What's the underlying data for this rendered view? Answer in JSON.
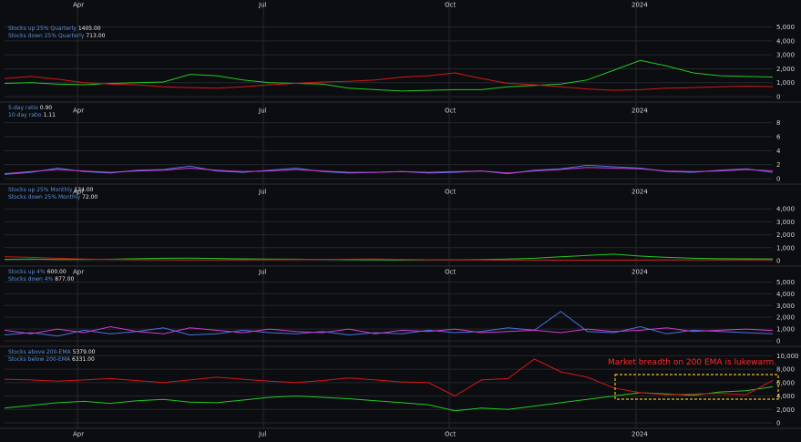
{
  "colors": {
    "background": "#0c0d10",
    "grid": "#23262d",
    "green": "#22c922",
    "red": "#d41717",
    "blue": "#4a72e0",
    "magenta": "#d13ad1",
    "annotation": "#ff2a2a",
    "highlight": "#e8c020"
  },
  "x_axis": {
    "months": [
      "Apr",
      "Jul",
      "Oct",
      "2024"
    ]
  },
  "annotation": "Market breadth on 200 EMA is lukewarm.",
  "chart_data": [
    {
      "type": "line",
      "legend": [
        {
          "label": "Stocks up 25% Quarterly",
          "value": "1405.00"
        },
        {
          "label": "Stocks down 25% Quarterly",
          "value": "713.00"
        }
      ],
      "yticks": [
        "5,000",
        "4,000",
        "3,000",
        "2,000",
        "1,000",
        "0"
      ],
      "ylim": [
        0,
        5500
      ],
      "series": [
        {
          "color": "green",
          "values": [
            950,
            1000,
            900,
            850,
            950,
            1000,
            1050,
            1600,
            1500,
            1200,
            1000,
            950,
            900,
            600,
            500,
            400,
            450,
            500,
            500,
            700,
            800,
            900,
            1200,
            1900,
            2600,
            2200,
            1700,
            1500,
            1450,
            1405
          ]
        },
        {
          "color": "red",
          "values": [
            1300,
            1450,
            1250,
            1000,
            900,
            850,
            700,
            650,
            600,
            700,
            850,
            950,
            1050,
            1100,
            1200,
            1400,
            1500,
            1700,
            1300,
            950,
            850,
            700,
            550,
            450,
            500,
            600,
            650,
            700,
            750,
            713
          ]
        }
      ]
    },
    {
      "type": "line",
      "legend": [
        {
          "label": "5-day ratio",
          "value": "0.90"
        },
        {
          "label": "10-day ratio",
          "value": "1.11"
        }
      ],
      "yticks": [
        "8",
        "6",
        "4",
        "2",
        "0"
      ],
      "ylim": [
        0,
        9
      ],
      "series": [
        {
          "color": "blue",
          "values": [
            0.6,
            0.9,
            1.5,
            1.0,
            0.8,
            1.2,
            1.3,
            1.8,
            1.1,
            0.9,
            1.2,
            1.5,
            1.0,
            0.8,
            0.9,
            1.0,
            0.8,
            0.9,
            1.1,
            0.7,
            1.2,
            1.4,
            1.9,
            1.7,
            1.5,
            1.0,
            0.9,
            1.2,
            1.4,
            0.9
          ]
        },
        {
          "color": "magenta",
          "values": [
            0.7,
            1.0,
            1.3,
            1.1,
            0.9,
            1.1,
            1.2,
            1.5,
            1.2,
            1.0,
            1.1,
            1.3,
            1.1,
            0.9,
            0.9,
            1.0,
            0.9,
            1.0,
            1.1,
            0.8,
            1.1,
            1.3,
            1.6,
            1.5,
            1.4,
            1.1,
            1.0,
            1.1,
            1.3,
            1.11
          ]
        }
      ]
    },
    {
      "type": "line",
      "legend": [
        {
          "label": "Stocks up 25% Monthly",
          "value": "134.00"
        },
        {
          "label": "Stocks down 25% Monthly",
          "value": "72.00"
        }
      ],
      "yticks": [
        "4,000",
        "3,000",
        "2,000",
        "1,000",
        "0"
      ],
      "ylim": [
        0,
        5000
      ],
      "series": [
        {
          "color": "green",
          "values": [
            100,
            120,
            90,
            100,
            110,
            150,
            180,
            200,
            170,
            140,
            120,
            110,
            100,
            80,
            70,
            60,
            70,
            80,
            90,
            120,
            180,
            300,
            400,
            500,
            350,
            250,
            180,
            150,
            140,
            134
          ]
        },
        {
          "color": "red",
          "values": [
            300,
            250,
            180,
            120,
            100,
            80,
            70,
            60,
            60,
            70,
            80,
            90,
            100,
            110,
            120,
            100,
            80,
            70,
            60,
            50,
            50,
            40,
            40,
            40,
            50,
            60,
            70,
            70,
            72,
            72
          ]
        }
      ]
    },
    {
      "type": "line",
      "legend": [
        {
          "label": "Stocks up 4%",
          "value": "600.00"
        },
        {
          "label": "Stocks down 4%",
          "value": "877.00"
        }
      ],
      "yticks": [
        "5,000",
        "4,000",
        "3,000",
        "2,000",
        "1,000",
        "0"
      ],
      "ylim": [
        0,
        5500
      ],
      "series": [
        {
          "color": "blue",
          "values": [
            500,
            700,
            400,
            900,
            600,
            800,
            1100,
            500,
            600,
            900,
            700,
            600,
            800,
            500,
            700,
            600,
            900,
            700,
            800,
            1100,
            900,
            2500,
            800,
            700,
            1200,
            600,
            900,
            800,
            700,
            600
          ]
        },
        {
          "color": "magenta",
          "values": [
            900,
            600,
            1000,
            700,
            1200,
            800,
            600,
            1100,
            900,
            700,
            1000,
            800,
            700,
            1000,
            600,
            900,
            800,
            1000,
            700,
            800,
            900,
            700,
            1000,
            800,
            900,
            1100,
            800,
            900,
            1000,
            877
          ]
        }
      ]
    },
    {
      "type": "line",
      "legend": [
        {
          "label": "Stocks above 200-EMA",
          "value": "5379.00"
        },
        {
          "label": "Stocks below 200-EMA",
          "value": "6331.00"
        }
      ],
      "yticks": [
        "10,000",
        "8,000",
        "6,000",
        "4,000",
        "2,000",
        "0"
      ],
      "ylim": [
        0,
        11000
      ],
      "series": [
        {
          "color": "green",
          "values": [
            2200,
            2600,
            3000,
            3200,
            2900,
            3300,
            3500,
            3100,
            3000,
            3400,
            3800,
            4000,
            3800,
            3600,
            3300,
            3000,
            2700,
            1800,
            2200,
            2000,
            2500,
            3000,
            3500,
            4000,
            4500,
            4300,
            4100,
            4600,
            4800,
            5379
          ]
        },
        {
          "color": "red",
          "values": [
            6500,
            6400,
            6200,
            6400,
            6600,
            6300,
            6000,
            6400,
            6800,
            6500,
            6200,
            6000,
            6300,
            6700,
            6400,
            6100,
            6000,
            4000,
            6400,
            6600,
            9500,
            7600,
            6800,
            5200,
            4500,
            4200,
            4300,
            4400,
            4200,
            6331
          ]
        }
      ]
    }
  ]
}
